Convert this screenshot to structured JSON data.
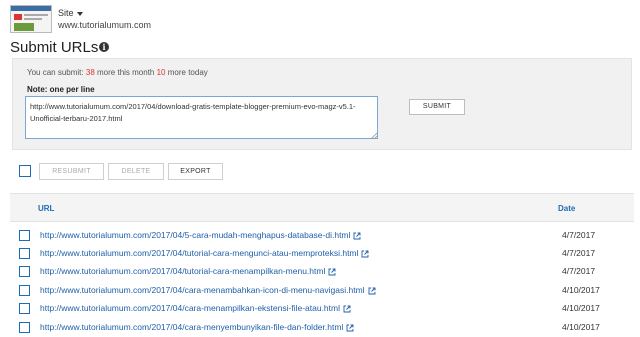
{
  "site": {
    "label": "Site",
    "url": "www.tutorialumum.com"
  },
  "page_title": "Submit URLs",
  "quota": {
    "prefix": "You can submit:",
    "month_count": "38",
    "month_text": "more this month",
    "today_count": "10",
    "today_text": "more today"
  },
  "note": "Note: one per line",
  "textarea_value": "http://www.tutorialumum.com/2017/04/download-gratis-template-blogger-premium-evo-magz-v5.1-Unofficial-terbaru-2017.html",
  "submit_label": "SUBMIT",
  "toolbar": {
    "resubmit": "RESUBMIT",
    "delete": "DELETE",
    "export": "EXPORT"
  },
  "table": {
    "col_url": "URL",
    "col_date": "Date",
    "rows": [
      {
        "url": "http://www.tutorialumum.com/2017/04/5-cara-mudah-menghapus-database-di.html",
        "date": "4/7/2017"
      },
      {
        "url": "http://www.tutorialumum.com/2017/04/tutorial-cara-mengunci-atau-memproteksi.html",
        "date": "4/7/2017"
      },
      {
        "url": "http://www.tutorialumum.com/2017/04/tutorial-cara-menampilkan-menu.html",
        "date": "4/7/2017"
      },
      {
        "url": "http://www.tutorialumum.com/2017/04/cara-menambahkan-icon-di-menu-navigasi.html",
        "date": "4/10/2017"
      },
      {
        "url": "http://www.tutorialumum.com/2017/04/cara-menampilkan-ekstensi-file-atau.html",
        "date": "4/10/2017"
      },
      {
        "url": "http://www.tutorialumum.com/2017/04/cara-menyembunyikan-file-dan-folder.html",
        "date": "4/10/2017"
      }
    ]
  },
  "icons": {
    "site_dropdown": "chevron-down-icon",
    "info": "info-icon",
    "external": "external-link-icon"
  },
  "colors": {
    "link": "#1f5fa8",
    "highlight_number": "#d9352b",
    "panel": "#f1f1f1"
  }
}
